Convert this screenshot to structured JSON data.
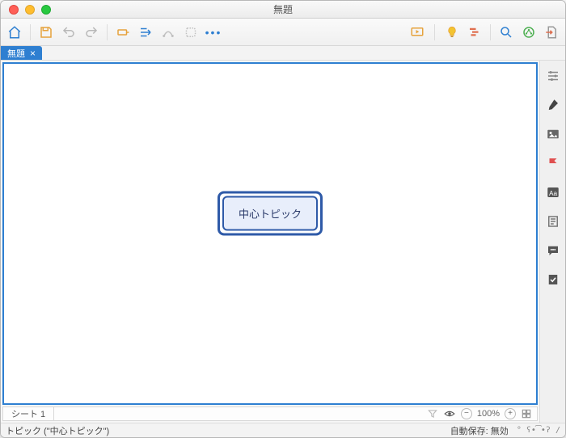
{
  "window": {
    "title": "無題"
  },
  "toolbar": {
    "home": "ホーム",
    "more": "•••"
  },
  "tab": {
    "label": "無題",
    "close": "×"
  },
  "canvas": {
    "central_topic": "中心トピック"
  },
  "sheet": {
    "label": "シート 1"
  },
  "zoom": {
    "value": "100%",
    "minus": "−",
    "plus": "+"
  },
  "statusbar": {
    "selection": "トピック (\"中心トピック\")",
    "autosave": "自動保存: 無効",
    "ascii": "° ʕ•͡•ʔ /"
  },
  "icons": {
    "eye": "eye",
    "filter": "filter",
    "overview": "overview"
  }
}
